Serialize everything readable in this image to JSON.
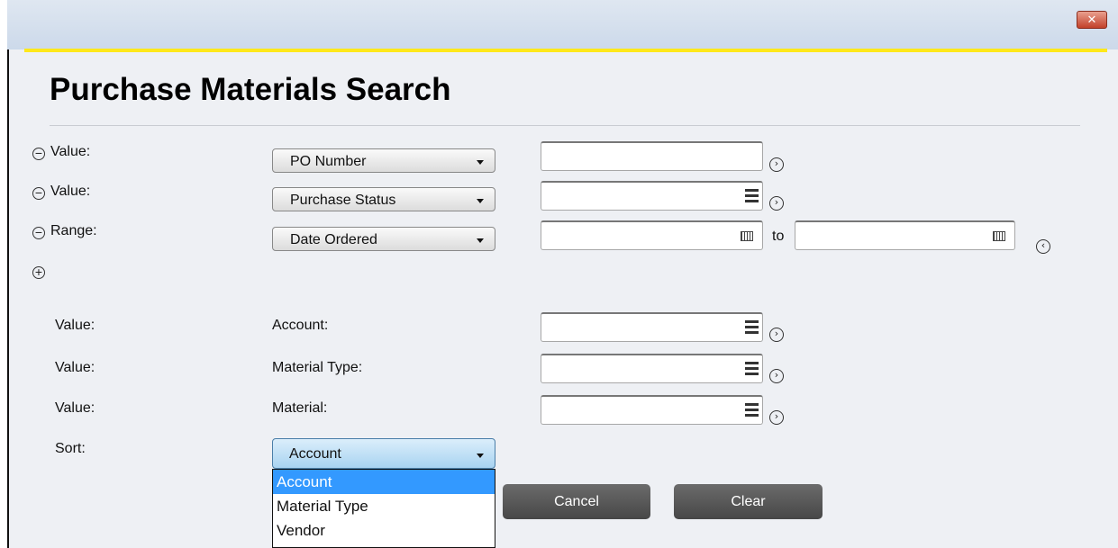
{
  "window": {
    "close_glyph": "✕"
  },
  "page_title": "Purchase Materials Search",
  "criteria_rows": [
    {
      "type_label": "Value:",
      "field": "PO Number",
      "remove_glyph": "−",
      "go_glyph": "›"
    },
    {
      "type_label": "Value:",
      "field": "Purchase Status",
      "remove_glyph": "−",
      "go_glyph": "›"
    },
    {
      "type_label": "Range:",
      "field": "Date Ordered",
      "to_label": "to",
      "remove_glyph": "−",
      "go_glyph": "‹"
    }
  ],
  "add_glyph": "+",
  "fixed_rows": [
    {
      "type_label": "Value:",
      "field_label": "Account:",
      "go_glyph": "›"
    },
    {
      "type_label": "Value:",
      "field_label": "Material Type:",
      "go_glyph": "›"
    },
    {
      "type_label": "Value:",
      "field_label": "Material:",
      "go_glyph": "›"
    }
  ],
  "sort": {
    "label": "Sort:",
    "selected": "Account",
    "options": [
      "Account",
      "Material Type",
      "Vendor"
    ]
  },
  "buttons": {
    "cancel": "Cancel",
    "clear": "Clear"
  },
  "icons": {
    "remove": "minus-circle-icon",
    "add": "plus-circle-icon",
    "go": "chevron-circle-icon",
    "list": "list-icon",
    "calendar": "calendar-icon"
  }
}
